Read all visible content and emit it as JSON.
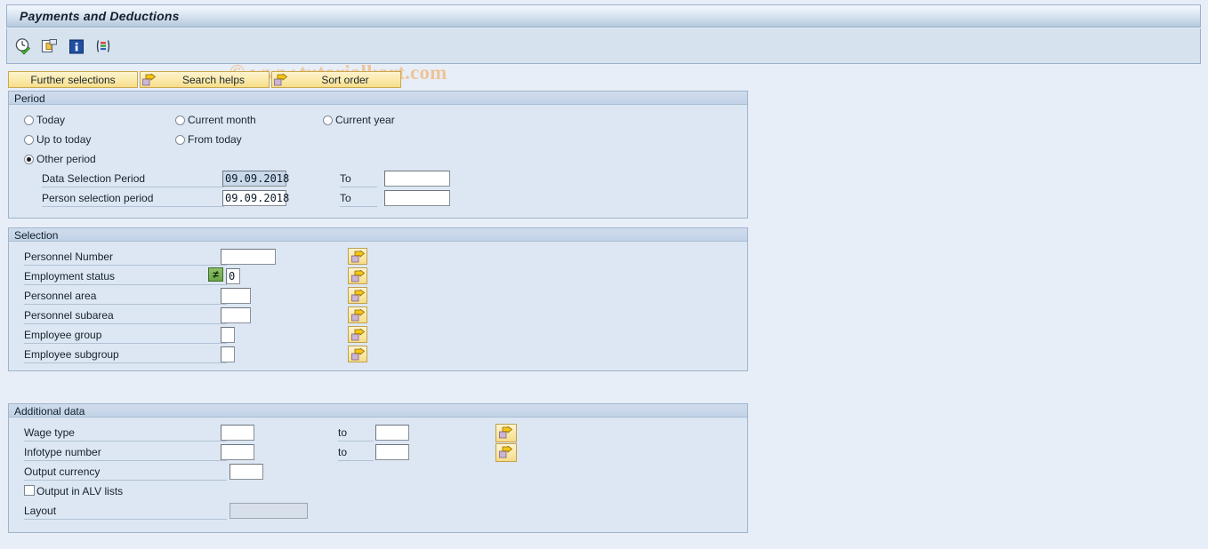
{
  "window": {
    "title": "Payments and Deductions"
  },
  "watermark": "© www.tutorialkart.com",
  "toolbar": {
    "icons": [
      {
        "name": "execute-clock-icon",
        "title": "Execute"
      },
      {
        "name": "copy-variant-icon",
        "title": "Get variant"
      },
      {
        "name": "info-icon",
        "title": "Information"
      },
      {
        "name": "colored-list-icon",
        "title": "Display list"
      }
    ]
  },
  "buttons": [
    {
      "label": "Further selections",
      "icon": null
    },
    {
      "label": "Search helps",
      "icon": "arrow-icon"
    },
    {
      "label": "Sort order",
      "icon": "arrow-icon"
    }
  ],
  "period": {
    "header": "Period",
    "options": [
      {
        "label": "Today",
        "selected": false
      },
      {
        "label": "Current month",
        "selected": false
      },
      {
        "label": "Current year",
        "selected": false
      },
      {
        "label": "Up to today",
        "selected": false
      },
      {
        "label": "From today",
        "selected": false
      },
      {
        "label": "Other period",
        "selected": true
      }
    ],
    "rows": [
      {
        "label": "Data Selection Period",
        "value": "09.09.2018",
        "focused": true,
        "to_label": "To",
        "to_value": ""
      },
      {
        "label": "Person selection period",
        "value": "09.09.2018",
        "focused": false,
        "to_label": "To",
        "to_value": ""
      }
    ]
  },
  "selection": {
    "header": "Selection",
    "rows": [
      {
        "label": "Personnel Number",
        "value": "",
        "width": 62,
        "op": null,
        "arrow": true
      },
      {
        "label": "Employment status",
        "value": "0",
        "width": 16,
        "op": "≠",
        "arrow": true
      },
      {
        "label": "Personnel area",
        "value": "",
        "width": 34,
        "op": null,
        "arrow": true
      },
      {
        "label": "Personnel subarea",
        "value": "",
        "width": 34,
        "op": null,
        "arrow": true
      },
      {
        "label": "Employee group",
        "value": "",
        "width": 16,
        "op": null,
        "arrow": true
      },
      {
        "label": "Employee subgroup",
        "value": "",
        "width": 16,
        "op": null,
        "arrow": true
      }
    ]
  },
  "additional": {
    "header": "Additional data",
    "rows": [
      {
        "label": "Wage type",
        "value": "",
        "width": 38,
        "to_label": "to",
        "to_value": "",
        "arrow": true
      },
      {
        "label": "Infotype number",
        "value": "",
        "width": 38,
        "to_label": "to",
        "to_value": "",
        "arrow": true
      },
      {
        "label": "Output currency",
        "value": "",
        "width": 38,
        "to_label": null,
        "to_value": null,
        "arrow": false
      }
    ],
    "checkbox": {
      "label": "Output in ALV lists",
      "checked": false
    },
    "layout": {
      "label": "Layout",
      "value": "",
      "disabled": true
    }
  },
  "colors": {
    "page_background": "#e8eef7",
    "panel_background": "#dce7f3",
    "title_accent": "#b6c9de",
    "button_yellow": "#fbe9a8",
    "watermark": "#eec49a",
    "op_green": "#6aa645"
  }
}
